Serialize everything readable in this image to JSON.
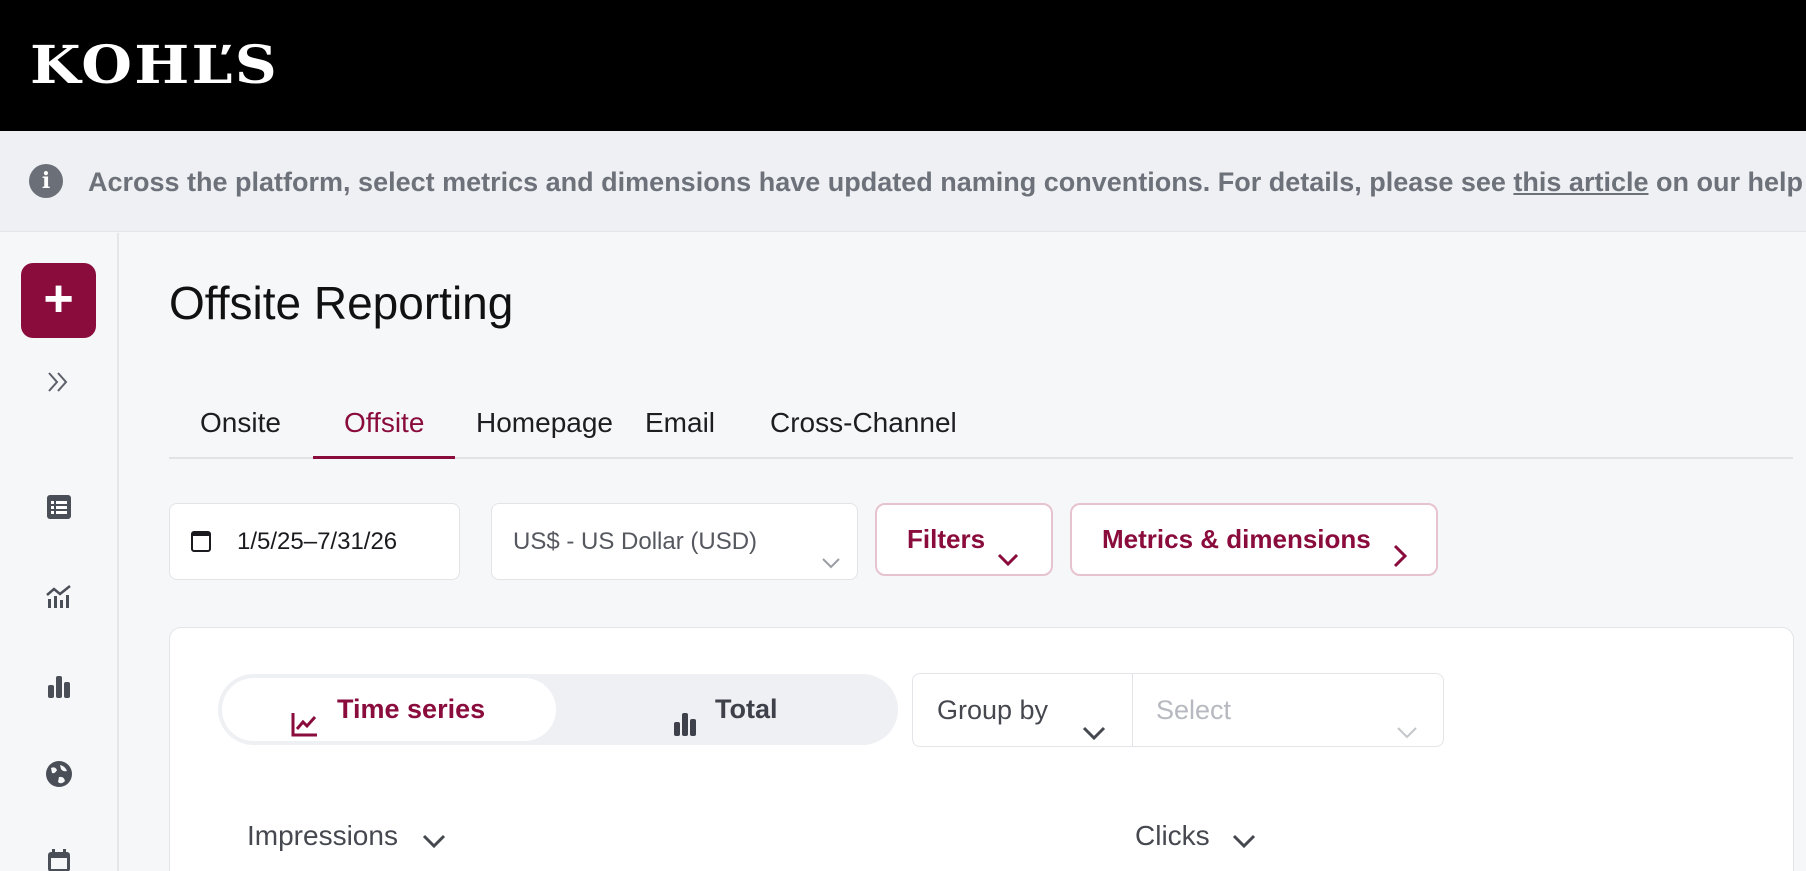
{
  "brand": {
    "logo_text": "KOHĽS",
    "accent": "#8a0c3c"
  },
  "banner": {
    "text_before": "Across the platform, select metrics and dimensions have updated naming conventions.  For details, please see ",
    "link_text": "this article",
    "text_after": " on our help center.",
    "icon": "info-icon"
  },
  "sidebar": {
    "create_label": "+",
    "expand_icon": "double-chevron-right-icon",
    "items": [
      {
        "icon": "list-icon"
      },
      {
        "icon": "analytics-icon"
      },
      {
        "icon": "bar-chart-icon"
      },
      {
        "icon": "globe-icon"
      },
      {
        "icon": "calendar-icon"
      }
    ]
  },
  "page": {
    "title": "Offsite Reporting"
  },
  "tabs": [
    {
      "label": "Onsite",
      "active": false
    },
    {
      "label": "Offsite",
      "active": true
    },
    {
      "label": "Homepage",
      "active": false
    },
    {
      "label": "Email",
      "active": false
    },
    {
      "label": "Cross-Channel",
      "active": false
    }
  ],
  "toolbar": {
    "date_range": "1/5/25–7/31/26",
    "currency": "US$ - US Dollar (USD)",
    "filters_label": "Filters",
    "metrics_label": "Metrics & dimensions"
  },
  "chart_controls": {
    "view_options": [
      {
        "label": "Time series",
        "selected": true
      },
      {
        "label": "Total",
        "selected": false
      }
    ],
    "group_by_label": "Group by",
    "select_placeholder": "Select",
    "metric_left": "Impressions",
    "metric_right": "Clicks"
  }
}
